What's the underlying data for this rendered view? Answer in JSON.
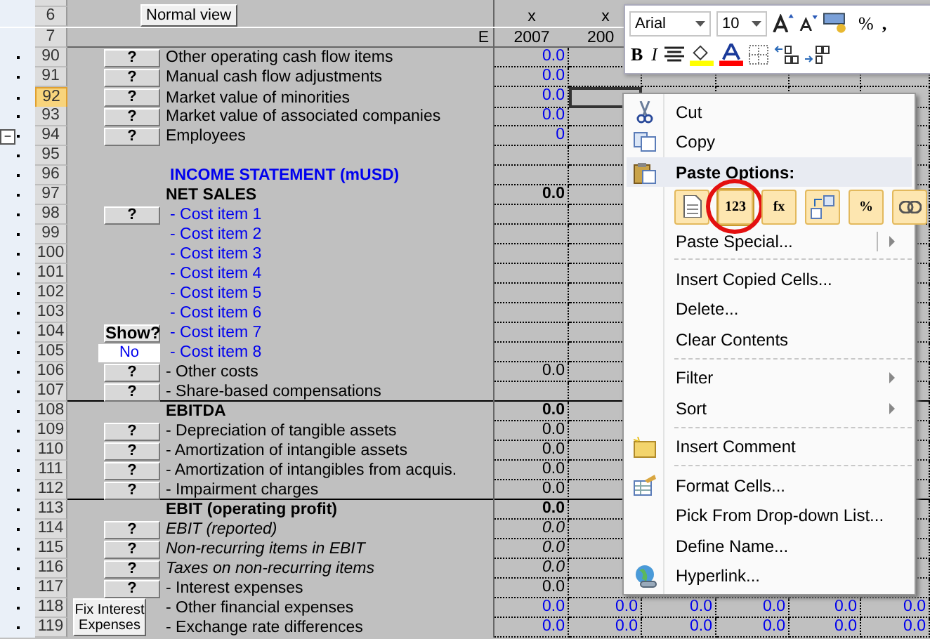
{
  "sheet": {
    "normal_view_button": "Normal view",
    "header_rows": [
      {
        "n": "6",
        "marks": [
          "x",
          "x"
        ]
      },
      {
        "n": "7",
        "col_e": "E",
        "years": [
          "2007",
          "200"
        ]
      }
    ],
    "rows": [
      {
        "n": "90",
        "selected": false,
        "button": {
          "kind": "help",
          "label": "?"
        },
        "label": "Other operating cash flow items",
        "kind": "input",
        "values": [
          "0.0"
        ]
      },
      {
        "n": "91",
        "selected": false,
        "button": {
          "kind": "help",
          "label": "?"
        },
        "label": "Manual cash flow adjustments",
        "kind": "input",
        "values": [
          "0.0"
        ]
      },
      {
        "n": "92",
        "selected": true,
        "button": {
          "kind": "help",
          "label": "?"
        },
        "label": "Market value of minorities",
        "kind": "input",
        "values": [
          "0.0"
        ]
      },
      {
        "n": "93",
        "selected": false,
        "button": {
          "kind": "help",
          "label": "?"
        },
        "label": "Market value of associated companies",
        "kind": "input",
        "values": [
          "0.0"
        ]
      },
      {
        "n": "94",
        "selected": false,
        "collapse": "−",
        "button": {
          "kind": "help",
          "label": "?"
        },
        "label": "Employees",
        "kind": "input",
        "values": [
          "0"
        ]
      },
      {
        "n": "95",
        "selected": false,
        "kind": "blank"
      },
      {
        "n": "96",
        "selected": false,
        "label": "INCOME STATEMENT (mUSD)",
        "kind": "section"
      },
      {
        "n": "97",
        "selected": false,
        "label": "NET SALES",
        "kind": "total",
        "values": [
          "0.0"
        ]
      },
      {
        "n": "98",
        "selected": false,
        "button": {
          "kind": "help",
          "label": "?"
        },
        "label": "- Cost item 1",
        "kind": "cost"
      },
      {
        "n": "99",
        "selected": false,
        "label": "- Cost item 2",
        "kind": "cost"
      },
      {
        "n": "100",
        "selected": false,
        "label": "- Cost item 3",
        "kind": "cost"
      },
      {
        "n": "101",
        "selected": false,
        "label": "- Cost item 4",
        "kind": "cost"
      },
      {
        "n": "102",
        "selected": false,
        "label": "- Cost item 5",
        "kind": "cost"
      },
      {
        "n": "103",
        "selected": false,
        "label": "- Cost item 6",
        "kind": "cost"
      },
      {
        "n": "104",
        "selected": false,
        "button": {
          "kind": "show",
          "label": "Show?"
        },
        "label": "- Cost item 7",
        "kind": "cost"
      },
      {
        "n": "105",
        "selected": false,
        "button": {
          "kind": "value",
          "label": "No"
        },
        "label": "- Cost item 8",
        "kind": "cost"
      },
      {
        "n": "106",
        "selected": false,
        "button": {
          "kind": "help",
          "label": "?"
        },
        "label": "- Other costs",
        "kind": "calc",
        "values": [
          "0.0"
        ]
      },
      {
        "n": "107",
        "selected": false,
        "button": {
          "kind": "help",
          "label": "?"
        },
        "label": "- Share-based compensations",
        "kind": "calc",
        "rule": true
      },
      {
        "n": "108",
        "selected": false,
        "label": "EBITDA",
        "kind": "total",
        "values": [
          "0.0"
        ]
      },
      {
        "n": "109",
        "selected": false,
        "button": {
          "kind": "help",
          "label": "?"
        },
        "label": "- Depreciation of tangible assets",
        "kind": "calc",
        "values": [
          "0.0"
        ]
      },
      {
        "n": "110",
        "selected": false,
        "button": {
          "kind": "help",
          "label": "?"
        },
        "label": "- Amortization of intangible assets",
        "kind": "calc",
        "values": [
          "0.0"
        ]
      },
      {
        "n": "111",
        "selected": false,
        "button": {
          "kind": "help",
          "label": "?"
        },
        "label": "- Amortization of intangibles from acquis.",
        "kind": "calc",
        "values": [
          "0.0"
        ]
      },
      {
        "n": "112",
        "selected": false,
        "button": {
          "kind": "help",
          "label": "?"
        },
        "label": "- Impairment charges",
        "kind": "calc",
        "values": [
          "0.0"
        ],
        "rule": true
      },
      {
        "n": "113",
        "selected": false,
        "label": "EBIT (operating profit)",
        "kind": "total",
        "values": [
          "0.0"
        ]
      },
      {
        "n": "114",
        "selected": false,
        "button": {
          "kind": "help",
          "label": "?"
        },
        "label": "EBIT (reported)",
        "kind": "memo",
        "values": [
          "0.0"
        ]
      },
      {
        "n": "115",
        "selected": false,
        "button": {
          "kind": "help",
          "label": "?"
        },
        "label": "Non-recurring items in EBIT",
        "kind": "memo",
        "values": [
          "0.0"
        ]
      },
      {
        "n": "116",
        "selected": false,
        "button": {
          "kind": "help",
          "label": "?"
        },
        "label": "Taxes on non-recurring items",
        "kind": "memo",
        "values": [
          "0.0"
        ]
      },
      {
        "n": "117",
        "selected": false,
        "button": {
          "kind": "help",
          "label": "?"
        },
        "label": "- Interest expenses",
        "kind": "calc",
        "values": [
          "0.0"
        ]
      },
      {
        "n": "118",
        "selected": false,
        "button": {
          "kind": "fix",
          "label": "Fix Interest Expenses"
        },
        "label": "- Other financial expenses",
        "kind": "input",
        "values": [
          "0.0",
          "0.0",
          "0.0",
          "0.0",
          "0.0",
          "0.0"
        ]
      },
      {
        "n": "119",
        "selected": false,
        "label": "- Exchange rate differences",
        "kind": "input",
        "values": [
          "0.0",
          "0.0",
          "0.0",
          "0.0",
          "0.0",
          "0.0"
        ]
      }
    ]
  },
  "mini_toolbar": {
    "font": "Arial",
    "size": "10",
    "percent": "%",
    "comma": ",",
    "bold": "B",
    "italic": "I"
  },
  "context_menu": {
    "items": [
      {
        "kind": "item",
        "label": "Cut"
      },
      {
        "kind": "item",
        "label": "Copy"
      },
      {
        "kind": "header",
        "label": "Paste Options:"
      },
      {
        "kind": "paste_row",
        "options": [
          {
            "highlighted": false
          },
          {
            "label": "123",
            "highlighted": true
          },
          {
            "label": "fx",
            "highlighted": false
          },
          {
            "highlighted": false
          },
          {
            "label": "%",
            "highlighted": false
          },
          {
            "highlighted": false
          }
        ]
      },
      {
        "kind": "split",
        "label": "Paste Special..."
      },
      {
        "kind": "separator"
      },
      {
        "kind": "item",
        "label": "Insert Copied Cells..."
      },
      {
        "kind": "item",
        "label": "Delete..."
      },
      {
        "kind": "item",
        "label": "Clear Contents"
      },
      {
        "kind": "separator"
      },
      {
        "kind": "submenu",
        "label": "Filter"
      },
      {
        "kind": "submenu",
        "label": "Sort"
      },
      {
        "kind": "separator"
      },
      {
        "kind": "item",
        "label": "Insert Comment"
      },
      {
        "kind": "separator"
      },
      {
        "kind": "item",
        "label": "Format Cells..."
      },
      {
        "kind": "item",
        "label": "Pick From Drop-down List..."
      },
      {
        "kind": "item",
        "label": "Define Name..."
      },
      {
        "kind": "item",
        "label": "Hyperlink..."
      }
    ]
  }
}
